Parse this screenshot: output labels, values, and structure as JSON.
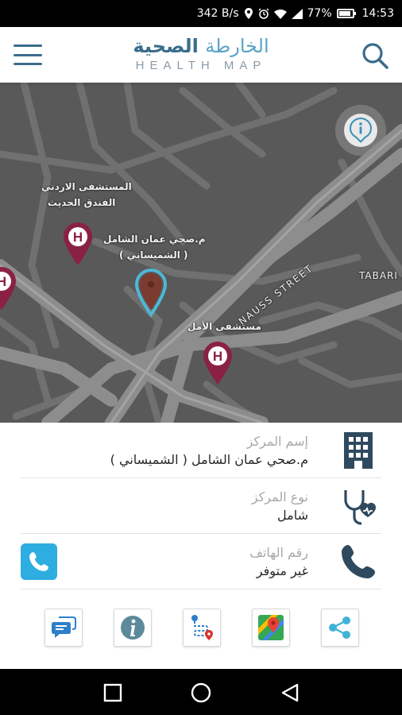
{
  "status_bar": {
    "speed": "342 B/s",
    "battery": "77%",
    "time": "14:53"
  },
  "header": {
    "logo_ar_part1": "الخارطة",
    "logo_ar_part2": "الصحية",
    "logo_en": "HEALTH MAP"
  },
  "map": {
    "labels": {
      "hospital_1": "المستشفى الاردني",
      "hospital_1_line2": "الفندق الحديث",
      "center_selected": "م.صحي عمان الشامل",
      "center_selected_line2": "( الشميساني )",
      "hospital_2": "مستشفى الأمل",
      "street_1": "NAUSS STREET",
      "street_2": "TABARI ST"
    },
    "colors": {
      "hospital_pin": "#8a2145",
      "selected_pin": "#7b3b2f",
      "selected_ring": "#4fb8d6"
    }
  },
  "details": {
    "center_name": {
      "label": "إسم المركز",
      "value": "م.صحي عمان الشامل ( الشميساني )",
      "icon": "building-icon"
    },
    "center_type": {
      "label": "نوع المركز",
      "value": "شامل",
      "icon": "stethoscope-heart-icon"
    },
    "phone": {
      "label": "رقم الهاتف",
      "value": "غير متوفر",
      "icon": "phone-icon"
    }
  },
  "actions": [
    "chat-icon",
    "info-icon",
    "route-icon",
    "google-maps-icon",
    "share-icon"
  ],
  "accent_color": "#2eaee0",
  "brand_color": "#3a6d8c"
}
